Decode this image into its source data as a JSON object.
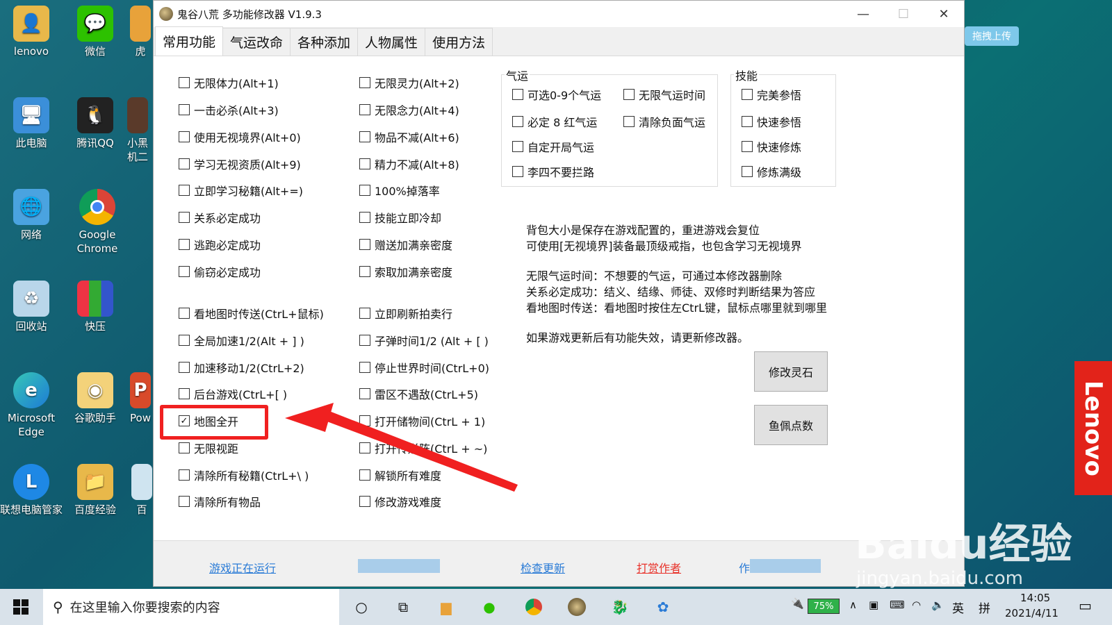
{
  "desktop": {
    "icons": [
      {
        "label": "lenovo"
      },
      {
        "label": "微信"
      },
      {
        "label": "此电脑"
      },
      {
        "label": "腾讯QQ"
      },
      {
        "label": "网络"
      },
      {
        "label": "Google Chrome"
      },
      {
        "label": "回收站"
      },
      {
        "label": "快压"
      },
      {
        "label": "Microsoft Edge"
      },
      {
        "label": "谷歌助手"
      },
      {
        "label": "联想电脑管家"
      },
      {
        "label": "百度经验"
      },
      {
        "label": "虎"
      },
      {
        "label": "小黑机二"
      },
      {
        "label": "Pow"
      },
      {
        "label": "百"
      }
    ],
    "upload_label": "拖拽上传",
    "lenovo_brand": "Lenovo",
    "watermark": "Baidu经验",
    "watermark_url": "jingyan.baidu.com"
  },
  "window": {
    "title": "鬼谷八荒 多功能修改器 V1.9.3",
    "controls": {
      "minimize": "—",
      "maximize": "☐",
      "close": "✕"
    }
  },
  "tabs": [
    {
      "label": "常用功能",
      "active": true
    },
    {
      "label": "气运改命",
      "active": false
    },
    {
      "label": "各种添加",
      "active": false
    },
    {
      "label": "人物属性",
      "active": false
    },
    {
      "label": "使用方法",
      "active": false
    }
  ],
  "left_col": [
    {
      "label": "无限体力(Alt+1)",
      "checked": false
    },
    {
      "label": "一击必杀(Alt+3)",
      "checked": false
    },
    {
      "label": "使用无视境界(Alt+0)",
      "checked": false
    },
    {
      "label": "学习无视资质(Alt+9)",
      "checked": false
    },
    {
      "label": "立即学习秘籍(Alt+=)",
      "checked": false
    },
    {
      "label": "关系必定成功",
      "checked": false
    },
    {
      "label": "逃跑必定成功",
      "checked": false
    },
    {
      "label": "偷窃必定成功",
      "checked": false
    },
    {
      "label": "看地图时传送(CtrL+鼠标)",
      "checked": false
    },
    {
      "label": "全局加速1/2(Alt + ] )",
      "checked": false
    },
    {
      "label": "加速移动1/2(CtrL+2)",
      "checked": false
    },
    {
      "label": "后台游戏(CtrL+[ )",
      "checked": false
    },
    {
      "label": "地图全开",
      "checked": true
    },
    {
      "label": "无限视距",
      "checked": false
    },
    {
      "label": "清除所有秘籍(CtrL+\\ )",
      "checked": false
    },
    {
      "label": "清除所有物品",
      "checked": false
    }
  ],
  "mid_col": [
    {
      "label": "无限灵力(Alt+2)",
      "checked": false
    },
    {
      "label": "无限念力(Alt+4)",
      "checked": false
    },
    {
      "label": "物品不减(Alt+6)",
      "checked": false
    },
    {
      "label": "精力不减(Alt+8)",
      "checked": false
    },
    {
      "label": "100%掉落率",
      "checked": false
    },
    {
      "label": "技能立即冷却",
      "checked": false
    },
    {
      "label": "赠送加满亲密度",
      "checked": false
    },
    {
      "label": "索取加满亲密度",
      "checked": false
    },
    {
      "label": "立即刷新拍卖行",
      "checked": false
    },
    {
      "label": "子弹时间1/2 (Alt + [ )",
      "checked": false
    },
    {
      "label": "停止世界时间(CtrL+0)",
      "checked": false
    },
    {
      "label": "雷区不遇敌(CtrL+5)",
      "checked": false
    },
    {
      "label": "打开储物间(CtrL + 1)",
      "checked": false
    },
    {
      "label": "打开传送阵(CtrL + ~)",
      "checked": false
    },
    {
      "label": "解锁所有难度",
      "checked": false
    },
    {
      "label": "修改游戏难度",
      "checked": false
    }
  ],
  "qiyun_group": {
    "label": "气运",
    "items": [
      {
        "label": "可选0-9个气运",
        "checked": false
      },
      {
        "label": "无限气运时间",
        "checked": false
      },
      {
        "label": "必定 8 红气运",
        "checked": false
      },
      {
        "label": "清除负面气运",
        "checked": false
      },
      {
        "label": "自定开局气运",
        "checked": false
      },
      {
        "label": "李四不要拦路",
        "checked": false
      }
    ]
  },
  "skill_group": {
    "label": "技能",
    "items": [
      {
        "label": "完美参悟",
        "checked": false
      },
      {
        "label": "快速参悟",
        "checked": false
      },
      {
        "label": "快速修炼",
        "checked": false
      },
      {
        "label": "修炼满级",
        "checked": false
      }
    ]
  },
  "info_lines": [
    "背包大小是保存在游戏配置的，重进游戏会复位",
    "可使用[无视境界]装备最顶级戒指，也包含学习无视境界",
    "无限气运时间：不想要的气运，可通过本修改器删除",
    "关系必定成功：结义、结缘、师徒、双修时判断结果为答应",
    "看地图时传送：看地图时按住左CtrL键，鼠标点哪里就到哪里",
    "如果游戏更新后有功能失效，请更新修改器。"
  ],
  "buttons": {
    "modify_stone": "修改灵石",
    "fish_points": "鱼佩点数"
  },
  "status": {
    "game_running": "游戏正在运行",
    "check_update": "检查更新",
    "reward_author": "打赏作者",
    "partial_text": "作"
  },
  "taskbar": {
    "search_placeholder": "在这里输入你要搜索的内容",
    "battery": "75%",
    "ime_lang": "英",
    "ime_mode": "拼",
    "time": "14:05",
    "date": "2021/4/11"
  }
}
